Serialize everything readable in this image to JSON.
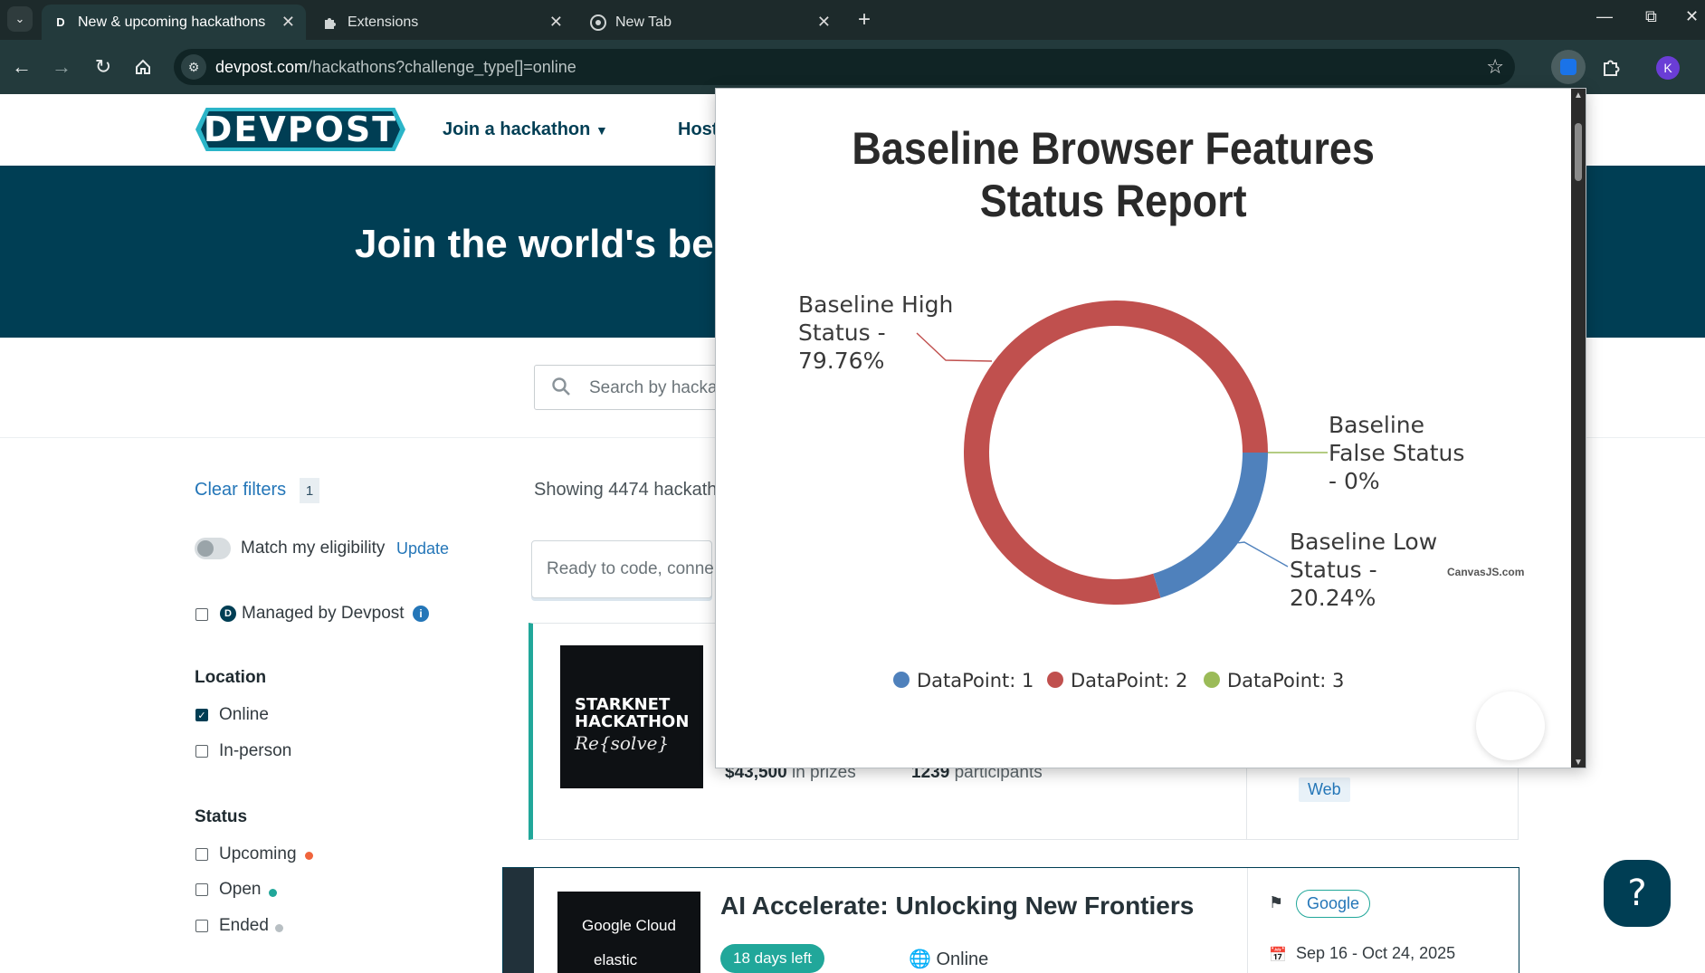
{
  "browser": {
    "tabs": [
      {
        "title": "New & upcoming hackathons ·",
        "favicon": "D",
        "active": true
      },
      {
        "title": "Extensions",
        "favicon": "puzzle-icon",
        "active": false
      },
      {
        "title": "New Tab",
        "favicon": "chrome-icon",
        "active": false
      }
    ],
    "url_host": "devpost.com",
    "url_path": "/hackathons?challenge_type[]=online",
    "profile_initial": "K"
  },
  "header": {
    "logo": "DEVPOST",
    "nav_join": "Join a hackathon",
    "nav_host": "Host"
  },
  "hero": {
    "title": "Join the world's bes"
  },
  "search": {
    "placeholder": "Search by hacka"
  },
  "filters": {
    "clear_label": "Clear filters",
    "clear_count": "1",
    "eligibility_label": "Match my eligibility",
    "eligibility_update": "Update",
    "managed_label": "Managed by Devpost",
    "location_heading": "Location",
    "location_online": "Online",
    "location_inperson": "In-person",
    "status_heading": "Status",
    "status_upcoming": "Upcoming",
    "status_open": "Open",
    "status_ended": "Ended"
  },
  "results": {
    "showing": "Showing 4474 hackath",
    "ready_placeholder": "Ready to code, conne"
  },
  "cards": [
    {
      "image_line1": "STARKNET",
      "image_line2": "HACKATHON",
      "image_line3": "Re{solve}",
      "prize_amount": "$43,500",
      "prize_label": "in prizes",
      "participants_count": "1239",
      "participants_label": "participants",
      "tag": "Web"
    },
    {
      "image_line1": "Google Cloud",
      "image_line2": "elastic",
      "title": "AI Accelerate: Unlocking New Frontiers",
      "days_left": "18 days left",
      "location": "Online",
      "host_tag": "Google",
      "dates": "Sep 16 - Oct 24, 2025"
    }
  ],
  "help_button": "?",
  "colors": {
    "brand_dark": "#003e54",
    "teal": "#21a79a",
    "link_blue": "#2476b8",
    "status_upcoming": "#f0643c",
    "status_open": "#21a79a",
    "status_ended": "#b8bfc3"
  },
  "chart_data": {
    "type": "pie",
    "subtype": "doughnut",
    "title": "Baseline Browser Features Status Report",
    "title_lines": [
      "Baseline Browser Features",
      "Status Report"
    ],
    "credit": "CanvasJS.com",
    "series": [
      {
        "legend": "DataPoint: 1",
        "label_lines": [
          "Baseline Low",
          "Status -",
          "20.24%"
        ],
        "value": 20.24,
        "color": "#4f81bc"
      },
      {
        "legend": "DataPoint: 2",
        "label_lines": [
          "Baseline High",
          "Status -",
          "79.76%"
        ],
        "value": 79.76,
        "color": "#c0504e"
      },
      {
        "legend": "DataPoint: 3",
        "label_lines": [
          "Baseline",
          "False Status",
          "- 0%"
        ],
        "value": 0,
        "color": "#9bbb58"
      }
    ],
    "legend_position": "bottom"
  }
}
